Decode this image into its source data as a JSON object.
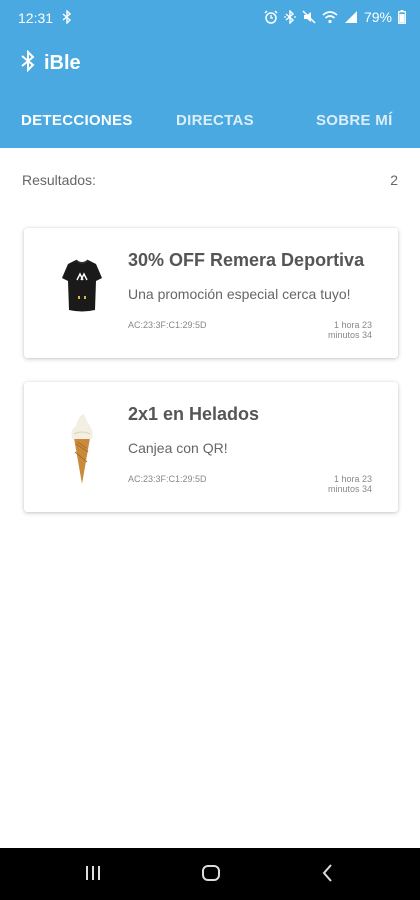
{
  "status_bar": {
    "time": "12:31",
    "battery": "79%",
    "icons": [
      "bluetooth-icon",
      "alarm-icon",
      "bluetooth-icon",
      "mute-icon",
      "wifi-icon",
      "signal-icon",
      "battery-icon"
    ]
  },
  "app_bar": {
    "title": "iBle",
    "logo_icon": "bluetooth-icon",
    "color": "#4aa9e0"
  },
  "tabs": [
    {
      "label": "DETECCIONES",
      "active": true
    },
    {
      "label": "DIRECTAS",
      "active": false
    },
    {
      "label": "SOBRE MÍ",
      "active": false
    }
  ],
  "results": {
    "label": "Resultados:",
    "count": "2"
  },
  "cards": [
    {
      "title": "30% OFF Remera Deportiva",
      "description": "Una promoción especial cerca tuyo!",
      "mac": "AC:23:3F:C1:29:5D",
      "time": "1 hora 23 minutos 34",
      "image": "tshirt-image"
    },
    {
      "title": "2x1 en Helados",
      "description": "Canjea con QR!",
      "mac": "AC:23:3F:C1:29:5D",
      "time": "1 hora 23 minutos 34",
      "image": "ice-cream-image"
    }
  ],
  "nav_bar": {
    "buttons": [
      "recent-apps-icon",
      "home-icon",
      "back-icon"
    ]
  }
}
